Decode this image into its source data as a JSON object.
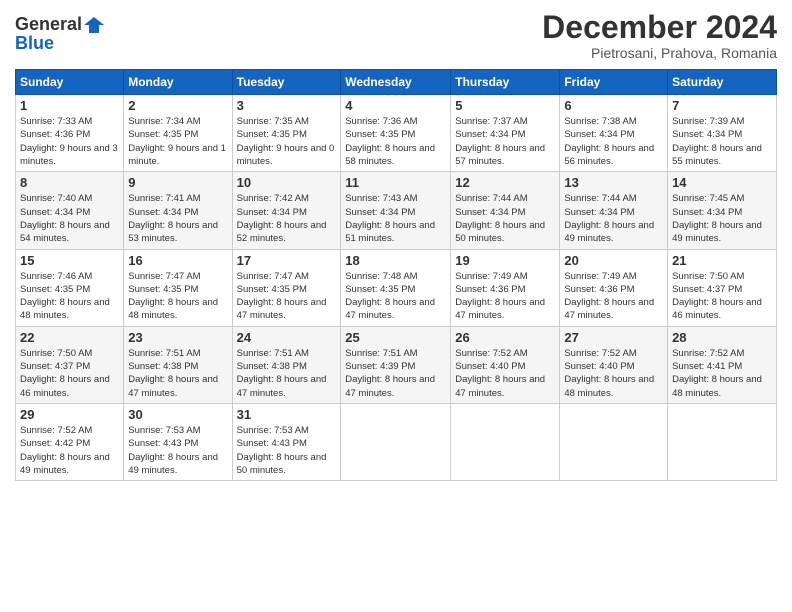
{
  "logo": {
    "line1": "General",
    "line2": "Blue"
  },
  "title": "December 2024",
  "subtitle": "Pietrosani, Prahova, Romania",
  "days_of_week": [
    "Sunday",
    "Monday",
    "Tuesday",
    "Wednesday",
    "Thursday",
    "Friday",
    "Saturday"
  ],
  "weeks": [
    [
      {
        "day": "1",
        "sunrise": "7:33 AM",
        "sunset": "4:36 PM",
        "daylight": "9 hours and 3 minutes."
      },
      {
        "day": "2",
        "sunrise": "7:34 AM",
        "sunset": "4:35 PM",
        "daylight": "9 hours and 1 minute."
      },
      {
        "day": "3",
        "sunrise": "7:35 AM",
        "sunset": "4:35 PM",
        "daylight": "9 hours and 0 minutes."
      },
      {
        "day": "4",
        "sunrise": "7:36 AM",
        "sunset": "4:35 PM",
        "daylight": "8 hours and 58 minutes."
      },
      {
        "day": "5",
        "sunrise": "7:37 AM",
        "sunset": "4:34 PM",
        "daylight": "8 hours and 57 minutes."
      },
      {
        "day": "6",
        "sunrise": "7:38 AM",
        "sunset": "4:34 PM",
        "daylight": "8 hours and 56 minutes."
      },
      {
        "day": "7",
        "sunrise": "7:39 AM",
        "sunset": "4:34 PM",
        "daylight": "8 hours and 55 minutes."
      }
    ],
    [
      {
        "day": "8",
        "sunrise": "7:40 AM",
        "sunset": "4:34 PM",
        "daylight": "8 hours and 54 minutes."
      },
      {
        "day": "9",
        "sunrise": "7:41 AM",
        "sunset": "4:34 PM",
        "daylight": "8 hours and 53 minutes."
      },
      {
        "day": "10",
        "sunrise": "7:42 AM",
        "sunset": "4:34 PM",
        "daylight": "8 hours and 52 minutes."
      },
      {
        "day": "11",
        "sunrise": "7:43 AM",
        "sunset": "4:34 PM",
        "daylight": "8 hours and 51 minutes."
      },
      {
        "day": "12",
        "sunrise": "7:44 AM",
        "sunset": "4:34 PM",
        "daylight": "8 hours and 50 minutes."
      },
      {
        "day": "13",
        "sunrise": "7:44 AM",
        "sunset": "4:34 PM",
        "daylight": "8 hours and 49 minutes."
      },
      {
        "day": "14",
        "sunrise": "7:45 AM",
        "sunset": "4:34 PM",
        "daylight": "8 hours and 49 minutes."
      }
    ],
    [
      {
        "day": "15",
        "sunrise": "7:46 AM",
        "sunset": "4:35 PM",
        "daylight": "8 hours and 48 minutes."
      },
      {
        "day": "16",
        "sunrise": "7:47 AM",
        "sunset": "4:35 PM",
        "daylight": "8 hours and 48 minutes."
      },
      {
        "day": "17",
        "sunrise": "7:47 AM",
        "sunset": "4:35 PM",
        "daylight": "8 hours and 47 minutes."
      },
      {
        "day": "18",
        "sunrise": "7:48 AM",
        "sunset": "4:35 PM",
        "daylight": "8 hours and 47 minutes."
      },
      {
        "day": "19",
        "sunrise": "7:49 AM",
        "sunset": "4:36 PM",
        "daylight": "8 hours and 47 minutes."
      },
      {
        "day": "20",
        "sunrise": "7:49 AM",
        "sunset": "4:36 PM",
        "daylight": "8 hours and 47 minutes."
      },
      {
        "day": "21",
        "sunrise": "7:50 AM",
        "sunset": "4:37 PM",
        "daylight": "8 hours and 46 minutes."
      }
    ],
    [
      {
        "day": "22",
        "sunrise": "7:50 AM",
        "sunset": "4:37 PM",
        "daylight": "8 hours and 46 minutes."
      },
      {
        "day": "23",
        "sunrise": "7:51 AM",
        "sunset": "4:38 PM",
        "daylight": "8 hours and 47 minutes."
      },
      {
        "day": "24",
        "sunrise": "7:51 AM",
        "sunset": "4:38 PM",
        "daylight": "8 hours and 47 minutes."
      },
      {
        "day": "25",
        "sunrise": "7:51 AM",
        "sunset": "4:39 PM",
        "daylight": "8 hours and 47 minutes."
      },
      {
        "day": "26",
        "sunrise": "7:52 AM",
        "sunset": "4:40 PM",
        "daylight": "8 hours and 47 minutes."
      },
      {
        "day": "27",
        "sunrise": "7:52 AM",
        "sunset": "4:40 PM",
        "daylight": "8 hours and 48 minutes."
      },
      {
        "day": "28",
        "sunrise": "7:52 AM",
        "sunset": "4:41 PM",
        "daylight": "8 hours and 48 minutes."
      }
    ],
    [
      {
        "day": "29",
        "sunrise": "7:52 AM",
        "sunset": "4:42 PM",
        "daylight": "8 hours and 49 minutes."
      },
      {
        "day": "30",
        "sunrise": "7:53 AM",
        "sunset": "4:43 PM",
        "daylight": "8 hours and 49 minutes."
      },
      {
        "day": "31",
        "sunrise": "7:53 AM",
        "sunset": "4:43 PM",
        "daylight": "8 hours and 50 minutes."
      },
      null,
      null,
      null,
      null
    ]
  ]
}
